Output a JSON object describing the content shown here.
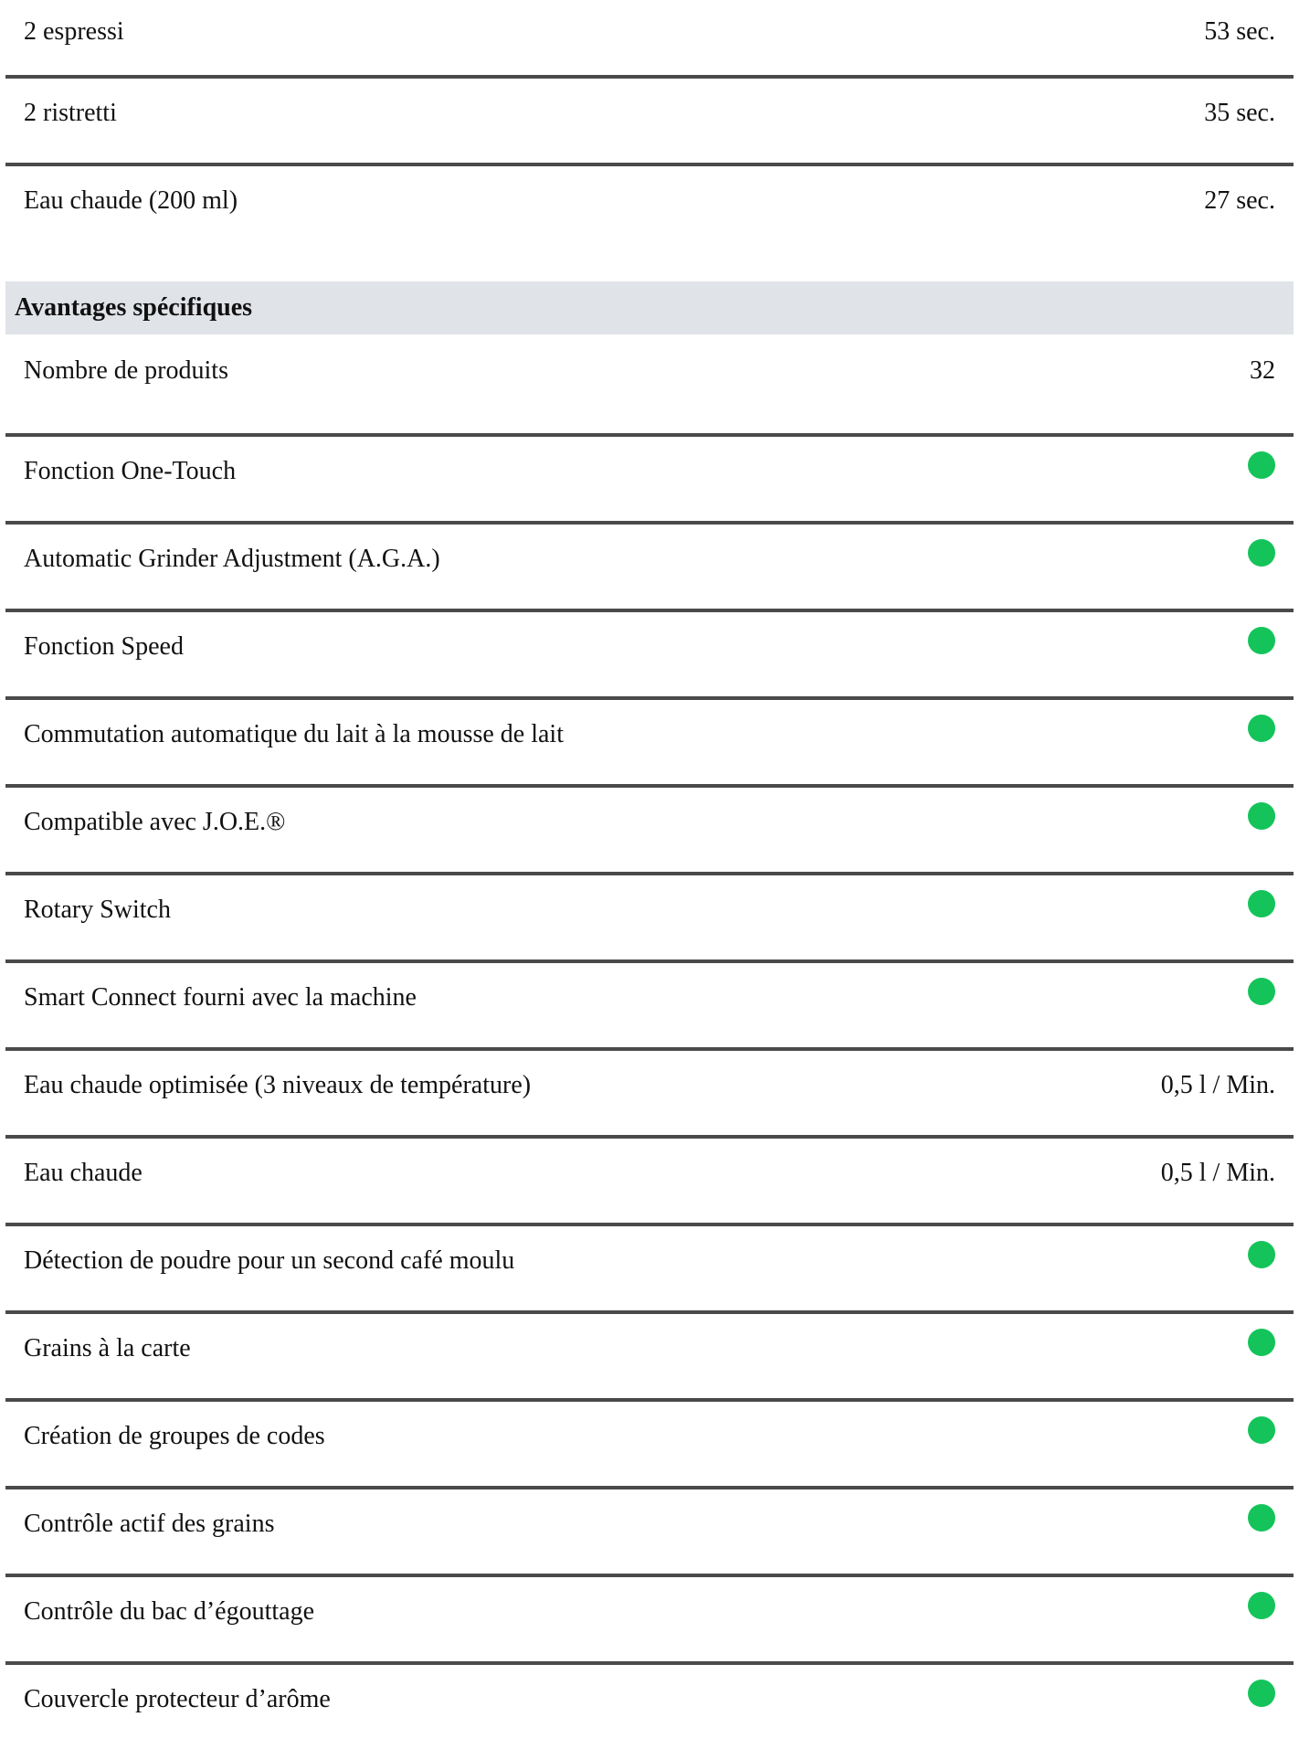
{
  "colors": {
    "indicator_green": "#14c45a",
    "divider": "#4a4a4a",
    "header_background": "#e0e3e8"
  },
  "top_rows": [
    {
      "label": "2 espressi",
      "value": "53 sec."
    },
    {
      "label": "2 ristretti",
      "value": "35 sec."
    },
    {
      "label": "Eau chaude (200 ml)",
      "value": "27 sec."
    }
  ],
  "section": {
    "title": "Avantages spécifiques",
    "rows": [
      {
        "label": "Nombre de produits",
        "value": "32"
      },
      {
        "label": "Fonction One-Touch",
        "indicator": "green-dot-icon"
      },
      {
        "label": "Automatic Grinder Adjustment (A.G.A.)",
        "indicator": "green-dot-icon"
      },
      {
        "label": "Fonction Speed",
        "indicator": "green-dot-icon"
      },
      {
        "label": "Commutation automatique du lait à la mousse de lait",
        "indicator": "green-dot-icon"
      },
      {
        "label": "Compatible avec J.O.E.®",
        "indicator": "green-dot-icon"
      },
      {
        "label": "Rotary Switch",
        "indicator": "green-dot-icon"
      },
      {
        "label": "Smart Connect fourni avec la machine",
        "indicator": "green-dot-icon"
      },
      {
        "label": "Eau chaude optimisée (3 niveaux de température)",
        "value": "0,5 l / Min."
      },
      {
        "label": "Eau chaude",
        "value": "0,5 l / Min."
      },
      {
        "label": "Détection de poudre pour un second café moulu",
        "indicator": "green-dot-icon"
      },
      {
        "label": "Grains à la carte",
        "indicator": "green-dot-icon"
      },
      {
        "label": "Création de groupes de codes",
        "indicator": "green-dot-icon"
      },
      {
        "label": "Contrôle actif des grains",
        "indicator": "green-dot-icon"
      },
      {
        "label": "Contrôle du bac d’égouttage",
        "indicator": "green-dot-icon"
      },
      {
        "label": "Couvercle protecteur d’arôme",
        "indicator": "green-dot-icon"
      }
    ]
  }
}
